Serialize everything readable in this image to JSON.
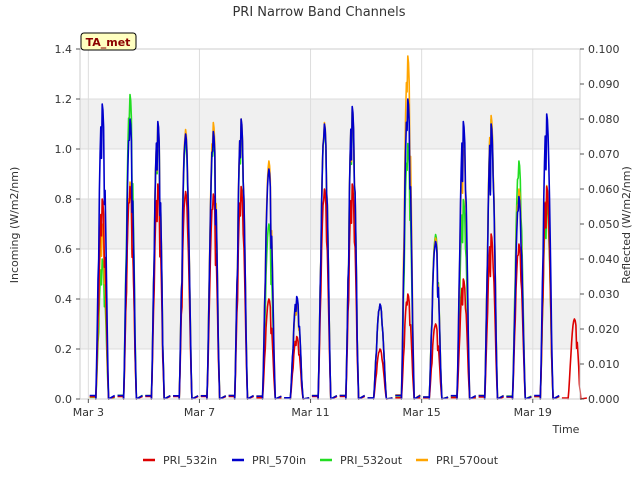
{
  "chart_data": {
    "type": "line",
    "title": "PRI Narrow Band Channels",
    "badge": "TA_met",
    "xlabel": "Time",
    "ylabel_left": "Incoming (W/m2/nm)",
    "ylabel_right": "Reflected (W/m2/nm)",
    "xlim_days": [
      2.7,
      20.7
    ],
    "x_ticks": [
      {
        "day": 3,
        "label": "Mar 3"
      },
      {
        "day": 7,
        "label": "Mar 7"
      },
      {
        "day": 11,
        "label": "Mar 11"
      },
      {
        "day": 15,
        "label": "Mar 15"
      },
      {
        "day": 19,
        "label": "Mar 19"
      }
    ],
    "ylim_left": [
      0,
      1.4
    ],
    "yticks_left": [
      "0.0",
      "0.2",
      "0.4",
      "0.6",
      "0.8",
      "1.0",
      "1.2",
      "1.4"
    ],
    "ylim_right": [
      0,
      0.1
    ],
    "yticks_right": [
      "0.000",
      "0.010",
      "0.020",
      "0.030",
      "0.040",
      "0.050",
      "0.060",
      "0.070",
      "0.080",
      "0.090",
      "0.100"
    ],
    "grid": true,
    "legend_position": "bottom",
    "daily_peaks": {
      "days": [
        3,
        4,
        5,
        6,
        7,
        8,
        9,
        10,
        11,
        12,
        13,
        14,
        15,
        16,
        17,
        18,
        19,
        20
      ],
      "PRI_532in": [
        0.8,
        0.85,
        0.86,
        0.83,
        0.82,
        0.85,
        0.4,
        0.25,
        0.84,
        0.86,
        0.2,
        0.42,
        0.3,
        0.48,
        0.66,
        0.62,
        0.85,
        0.32
      ],
      "PRI_570in": [
        1.18,
        1.12,
        1.11,
        1.06,
        1.07,
        1.12,
        0.92,
        0.41,
        1.1,
        1.17,
        0.38,
        1.2,
        0.63,
        1.11,
        1.1,
        0.81,
        1.14,
        0.0
      ],
      "PRI_532out": [
        0.04,
        0.087,
        0.078,
        0.074,
        0.075,
        0.078,
        0.05,
        0.028,
        0.078,
        0.082,
        0.027,
        0.073,
        0.047,
        0.057,
        0.08,
        0.068,
        0.057,
        0.0
      ],
      "PRI_570out": [
        0.05,
        0.062,
        0.079,
        0.077,
        0.079,
        0.08,
        0.068,
        0.028,
        0.079,
        0.083,
        0.027,
        0.098,
        0.046,
        0.075,
        0.081,
        0.06,
        0.061,
        0.0
      ]
    },
    "series": [
      {
        "name": "PRI_532in",
        "color": "#dd0000",
        "axis": "left"
      },
      {
        "name": "PRI_570in",
        "color": "#0000cc",
        "axis": "left"
      },
      {
        "name": "PRI_532out",
        "color": "#22dd22",
        "axis": "right"
      },
      {
        "name": "PRI_570out",
        "color": "#ffa500",
        "axis": "right"
      }
    ]
  }
}
